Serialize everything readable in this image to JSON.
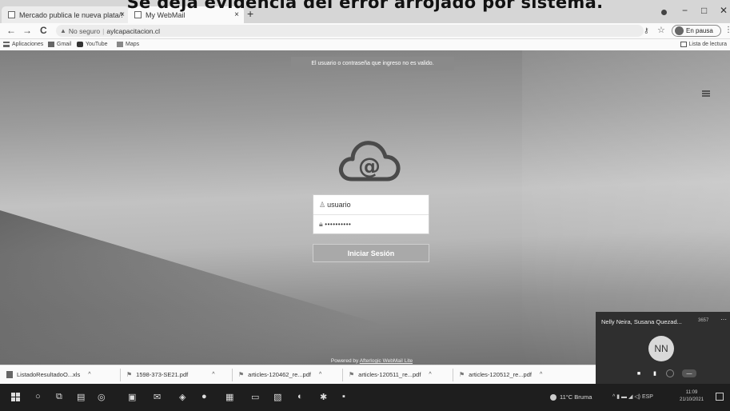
{
  "caption": "Se deja evidencia del error arrojado por sistema.",
  "browser": {
    "tabs": [
      {
        "title": "Mercado publica le nueva plata/!",
        "close": "×"
      },
      {
        "title": "My WebMail",
        "close": "×"
      }
    ],
    "new_tab": "+",
    "window_controls": {
      "minimize": "−",
      "maximize": "□",
      "close": "✕"
    },
    "nav": {
      "back": "←",
      "forward": "→",
      "reload": "C"
    },
    "address": {
      "security": "No seguro",
      "url": "aylcapacitacion.cl"
    },
    "profile_label": "Incógnito",
    "profile_short": "En pausa",
    "bookmarks": [
      {
        "label": "Aplicaciones",
        "icon": "apps-icon"
      },
      {
        "label": "Gmail",
        "icon": "gmail-icon"
      },
      {
        "label": "YouTube",
        "icon": "youtube-icon"
      },
      {
        "label": "Maps",
        "icon": "maps-icon"
      }
    ],
    "reading_list": "Lista de lectura"
  },
  "webmail": {
    "error_message": "El usuario o contraseña que ingreso no es valido.",
    "username_placeholder": "usuario",
    "password_mask": "••••••••••",
    "login_button": "Iniciar Sesión",
    "powered_by_prefix": "Powered by ",
    "powered_by_link": "Afterlogic WebMail Lite"
  },
  "call": {
    "participants": "Nelly Neira, Susana Quezad...",
    "extra": "3657",
    "avatar_initials": "NN"
  },
  "downloads": [
    {
      "name": "ListadoResultadoO...xls",
      "icon": "excel-file-icon"
    },
    {
      "name": "1598-373-SE21.pdf",
      "icon": "pdf-file-icon"
    },
    {
      "name": "articles-120462_re...pdf",
      "icon": "pdf-file-icon"
    },
    {
      "name": "articles-120511_re...pdf",
      "icon": "pdf-file-icon"
    },
    {
      "name": "articles-120512_re...pdf",
      "icon": "pdf-file-icon"
    }
  ],
  "taskbar": {
    "weather": "11°C Bruma",
    "language": "ESP",
    "time": "11:09",
    "date": "21/10/2021"
  }
}
